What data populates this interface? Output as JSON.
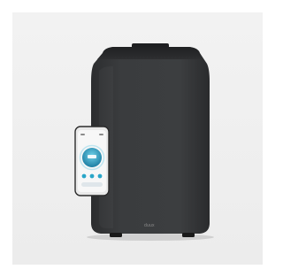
{
  "product": {
    "brand": "duux",
    "phone_screen_value": "",
    "colors": {
      "background": "#eeeeee",
      "body": "#3a3c3e",
      "body_dark": "#2a2b2d",
      "screen_accent": "#2aa6c8"
    }
  }
}
